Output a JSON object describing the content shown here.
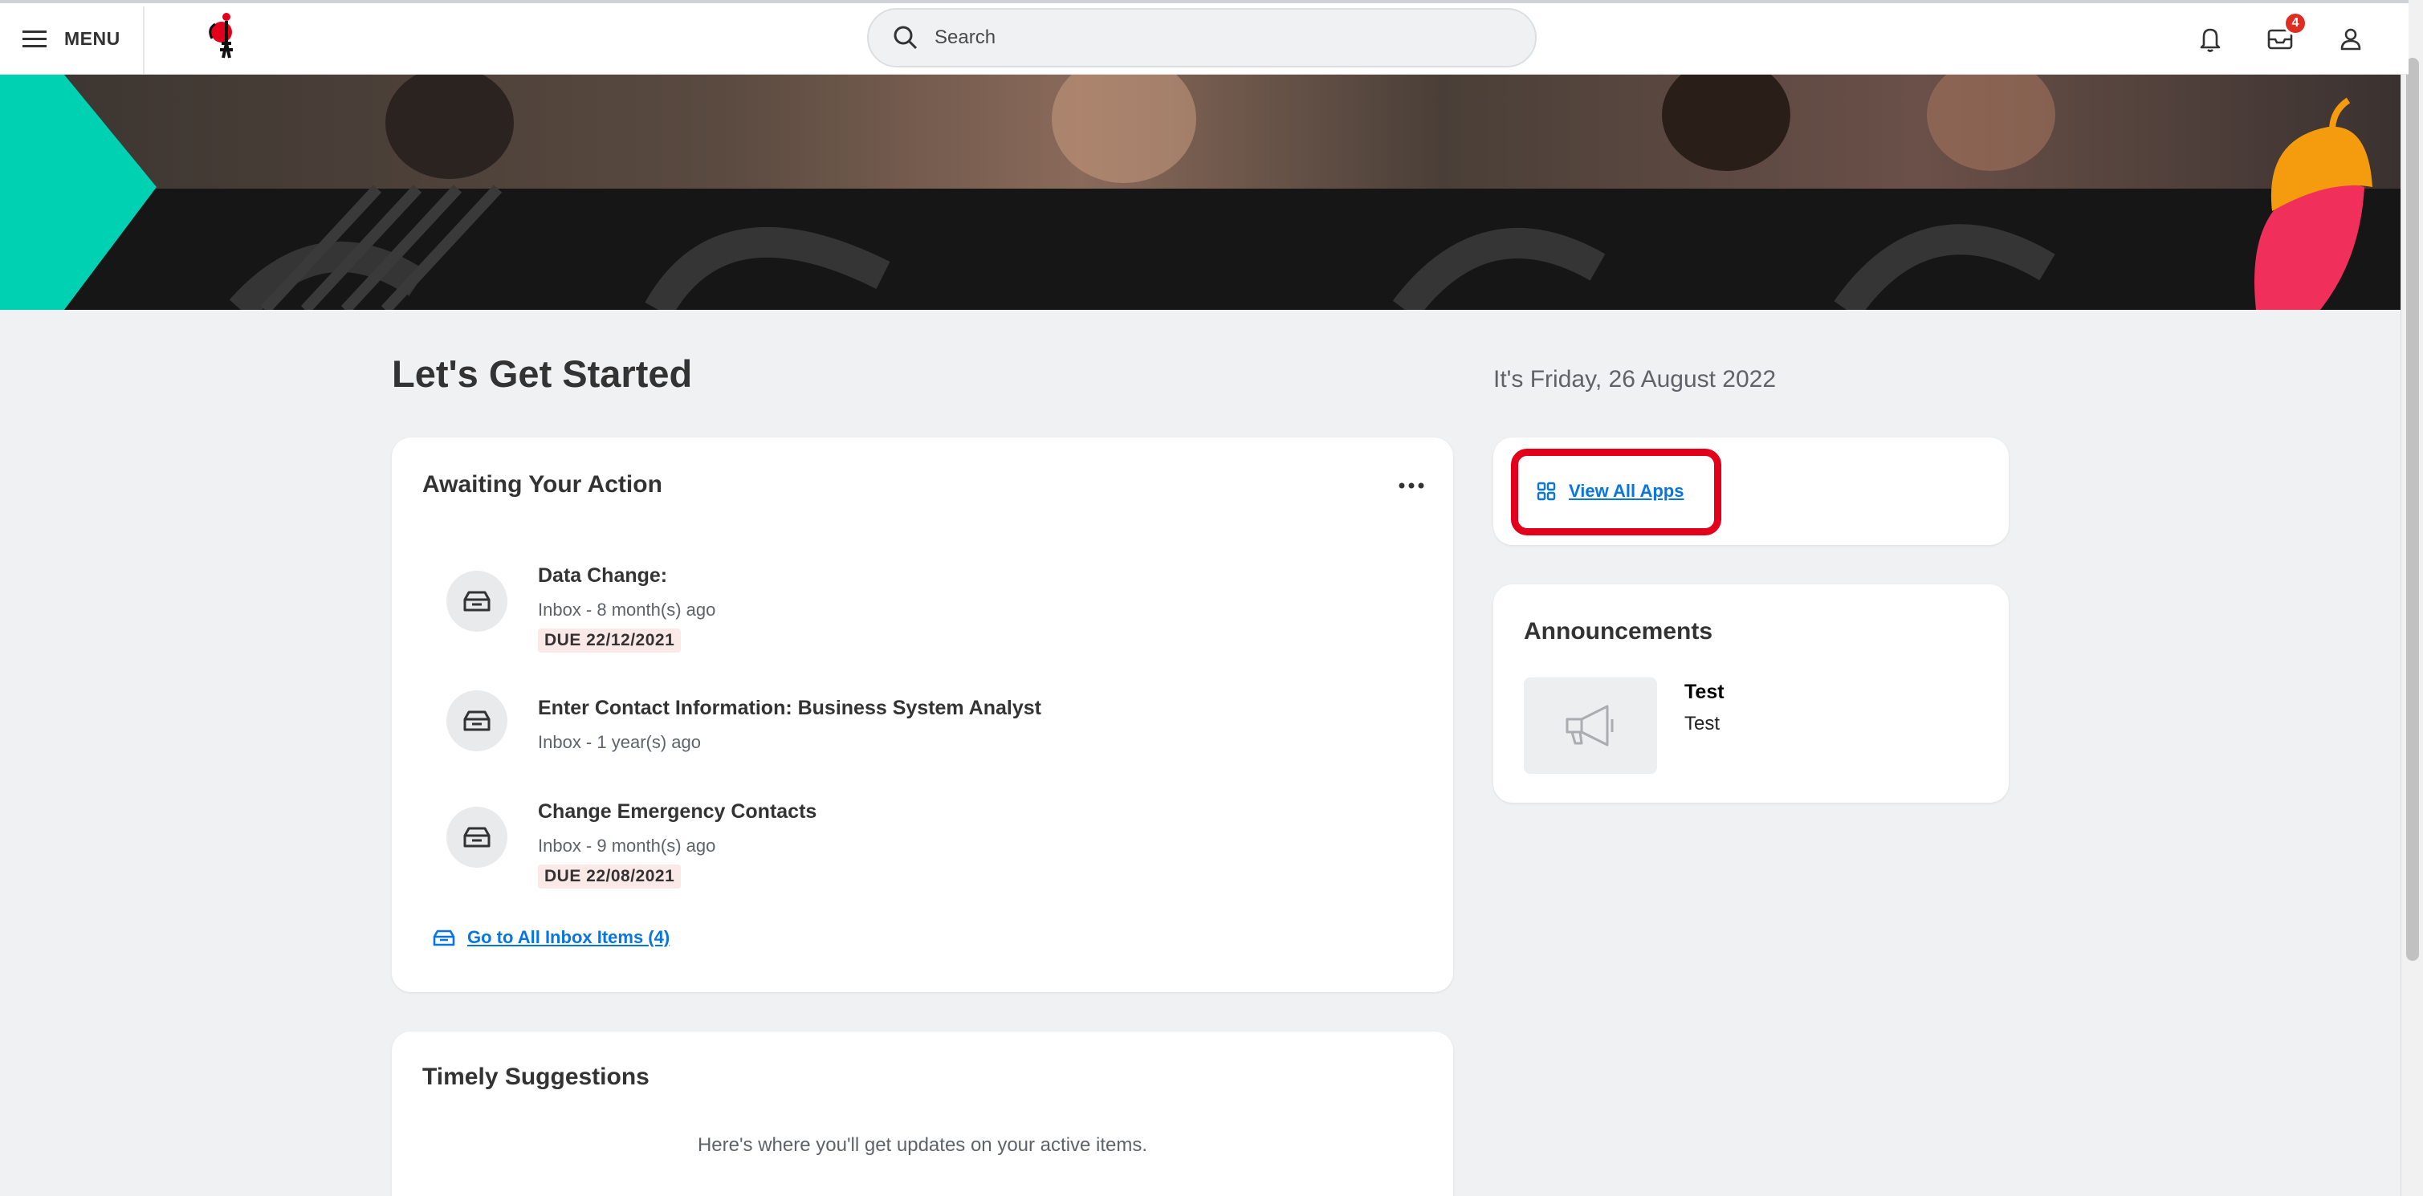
{
  "header": {
    "menu_label": "MENU",
    "search_placeholder": "Search",
    "inbox_badge": "4"
  },
  "main": {
    "page_title": "Let's Get Started",
    "date_text": "It's Friday, 26 August 2022"
  },
  "awaiting": {
    "title": "Awaiting Your Action",
    "tasks": [
      {
        "title": "Data Change:",
        "subtitle": "Inbox - 8 month(s) ago",
        "due": "DUE 22/12/2021"
      },
      {
        "title": "Enter Contact Information: Business System Analyst",
        "subtitle": "Inbox - 1 year(s) ago"
      },
      {
        "title": "Change Emergency Contacts",
        "subtitle": "Inbox - 9 month(s) ago",
        "due": "DUE 22/08/2021"
      }
    ],
    "inbox_link": "Go to All Inbox Items (4)"
  },
  "apps": {
    "link_label": "View All Apps"
  },
  "announcements": {
    "title": "Announcements",
    "items": [
      {
        "title": "Test",
        "body": "Test"
      }
    ]
  },
  "suggestions": {
    "title": "Timely Suggestions",
    "empty_text": "Here's where you'll get updates on your active items."
  },
  "colors": {
    "link": "#0875e1",
    "highlight": "#e3001b",
    "badge": "#de2e21",
    "banner_teal": "#00d1b2",
    "banner_dark": "#1a1a1a"
  },
  "icons": [
    "menu-icon",
    "logo",
    "search-icon",
    "bell-icon",
    "inbox-icon",
    "user-icon",
    "more-icon",
    "tray-icon",
    "grid-icon",
    "megaphone-icon"
  ]
}
